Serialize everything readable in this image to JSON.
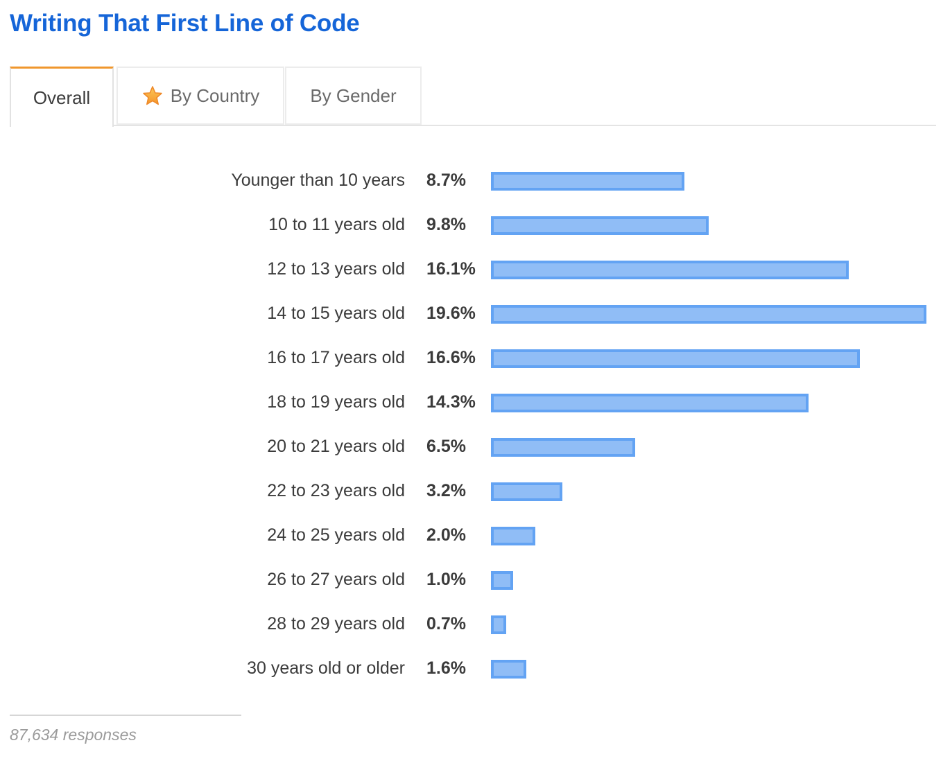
{
  "title": "Writing That First Line of Code",
  "tabs": [
    {
      "label": "Overall",
      "active": true,
      "icon": null
    },
    {
      "label": "By Country",
      "active": false,
      "icon": "star-icon"
    },
    {
      "label": "By Gender",
      "active": false,
      "icon": null
    }
  ],
  "colors": {
    "title": "#1565d8",
    "active_tab_accent": "#f0972d",
    "bar_fill": "#90bdf6",
    "bar_border": "#63a3f3",
    "star": "#f7a93a"
  },
  "chart_data": {
    "type": "bar",
    "orientation": "horizontal",
    "title": "Writing That First Line of Code",
    "xlabel": "",
    "ylabel": "",
    "unit": "%",
    "categories": [
      "Younger than 10 years",
      "10 to 11 years old",
      "12 to 13 years old",
      "14 to 15 years old",
      "16 to 17 years old",
      "18 to 19 years old",
      "20 to 21 years old",
      "22 to 23 years old",
      "24 to 25 years old",
      "26 to 27 years old",
      "28 to 29 years old",
      "30 years old or older"
    ],
    "values": [
      8.7,
      9.8,
      16.1,
      19.6,
      16.6,
      14.3,
      6.5,
      3.2,
      2.0,
      1.0,
      0.7,
      1.6
    ],
    "value_labels": [
      "8.7%",
      "9.8%",
      "16.1%",
      "19.6%",
      "16.6%",
      "14.3%",
      "6.5%",
      "3.2%",
      "2.0%",
      "1.0%",
      "0.7%",
      "1.6%"
    ],
    "xlim": [
      0,
      19.6
    ],
    "grid": false,
    "legend": "none"
  },
  "footer": {
    "responses": "87,634 responses"
  }
}
